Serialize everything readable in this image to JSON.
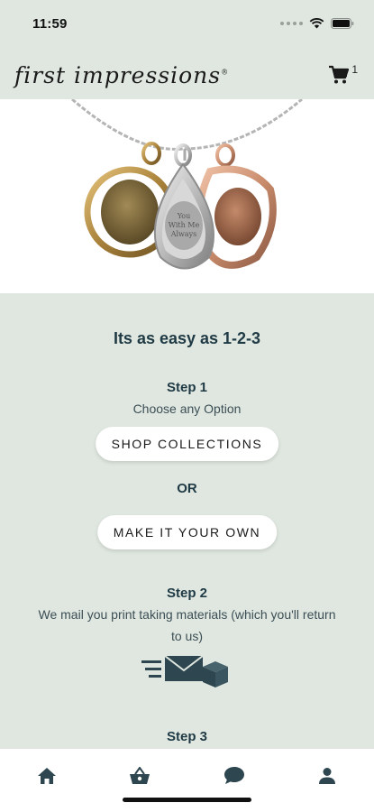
{
  "status": {
    "time": "11:59"
  },
  "header": {
    "logo_text": "first impressions",
    "cart_count": "1"
  },
  "hero": {
    "pendant_inscription_line1": "You",
    "pendant_inscription_line2": "With Me",
    "pendant_inscription_line3": "Always"
  },
  "main": {
    "headline": "Its as easy as 1-2-3",
    "step1": {
      "title": "Step 1",
      "desc": "Choose any Option"
    },
    "shop_button": "SHOP COLLECTIONS",
    "or_label": "OR",
    "make_button": "MAKE IT YOUR OWN",
    "step2": {
      "title": "Step 2",
      "desc": "We mail you print taking materials (which you'll return to us)"
    },
    "step3": {
      "title": "Step 3"
    }
  },
  "tabbar": {
    "items": [
      "home-icon",
      "basket-icon",
      "chat-icon",
      "account-icon"
    ]
  },
  "colors": {
    "background": "#dfe7e0",
    "text": "#1f3a44",
    "icon": "#2e4650"
  }
}
